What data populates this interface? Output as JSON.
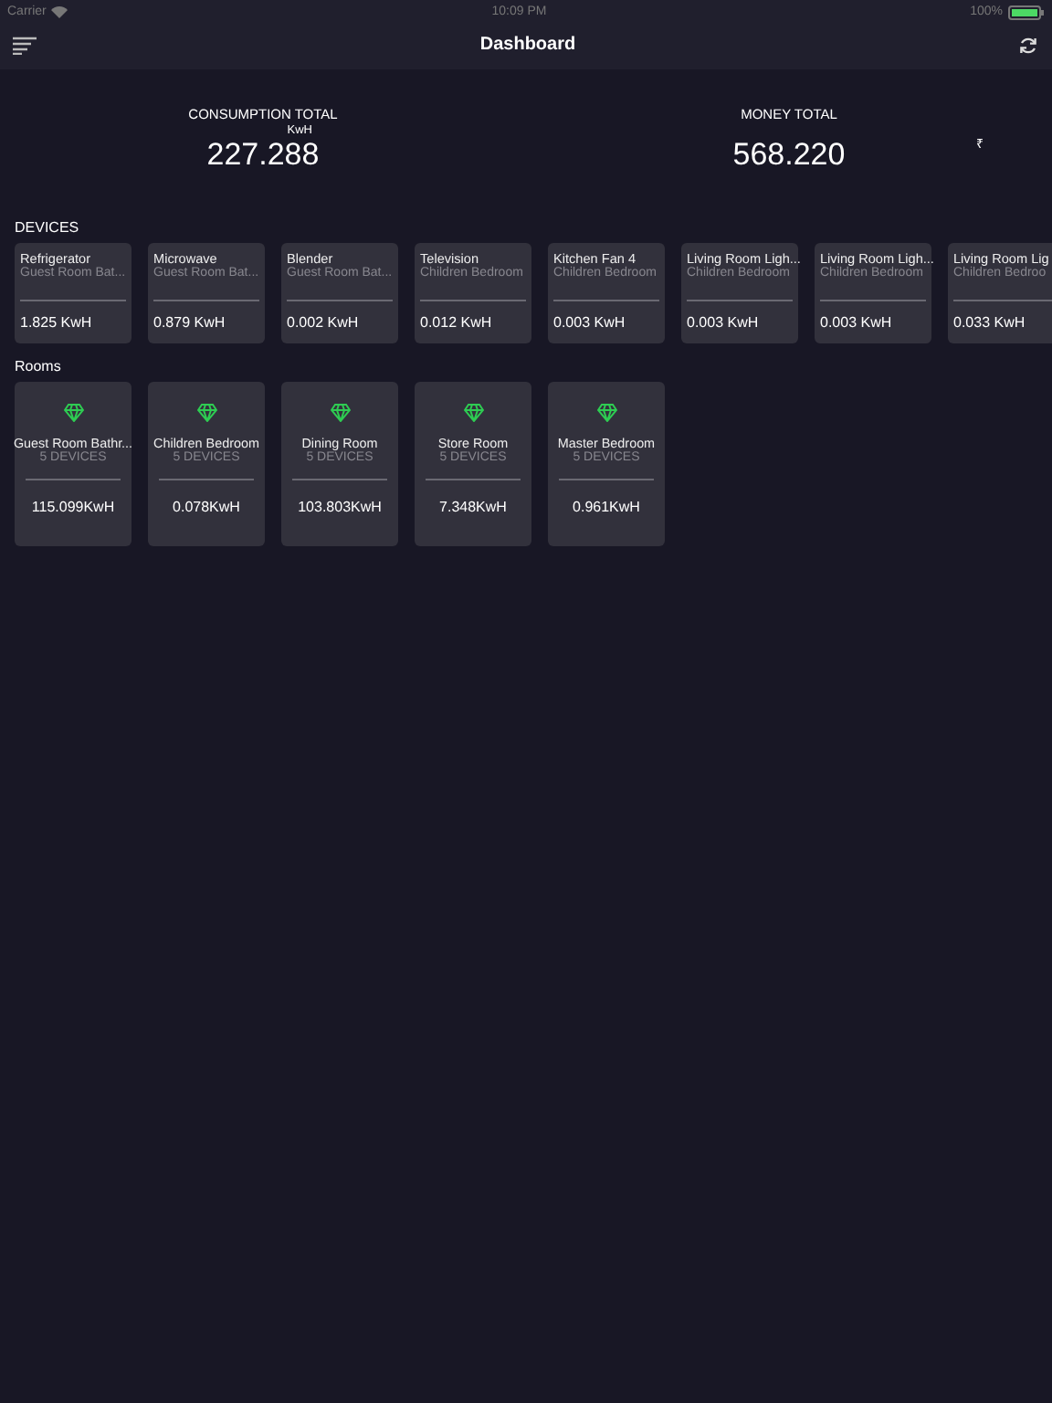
{
  "status_bar": {
    "carrier": "Carrier",
    "time": "10:09 PM",
    "battery": "100%"
  },
  "nav": {
    "title": "Dashboard"
  },
  "totals": [
    {
      "label": "CONSUMPTION TOTAL",
      "unit": "KwH",
      "value": "227.288"
    },
    {
      "label": "MONEY TOTAL",
      "unit": "₹",
      "value": "568.220"
    }
  ],
  "devices": {
    "heading": "DEVICES",
    "items": [
      {
        "name": "Refrigerator",
        "room": "Guest Room Bat...",
        "usage": "1.825 KwH"
      },
      {
        "name": "Microwave",
        "room": "Guest Room Bat...",
        "usage": "0.879 KwH"
      },
      {
        "name": "Blender",
        "room": "Guest Room Bat...",
        "usage": "0.002 KwH"
      },
      {
        "name": "Television",
        "room": "Children Bedroom",
        "usage": "0.012 KwH"
      },
      {
        "name": "Kitchen Fan 4",
        "room": "Children Bedroom",
        "usage": "0.003 KwH"
      },
      {
        "name": "Living Room Ligh...",
        "room": "Children Bedroom",
        "usage": "0.003 KwH"
      },
      {
        "name": "Living Room Ligh...",
        "room": "Children Bedroom",
        "usage": "0.003 KwH"
      },
      {
        "name": "Living Room Lig",
        "room": "Children Bedroo",
        "usage": "0.033 KwH"
      }
    ]
  },
  "rooms": {
    "heading": "Rooms",
    "items": [
      {
        "name": "Guest Room Bathr...",
        "devices": "5 DEVICES",
        "usage": "115.099KwH"
      },
      {
        "name": "Children Bedroom",
        "devices": "5 DEVICES",
        "usage": "0.078KwH"
      },
      {
        "name": "Dining Room",
        "devices": "5 DEVICES",
        "usage": "103.803KwH"
      },
      {
        "name": "Store Room",
        "devices": "5 DEVICES",
        "usage": "7.348KwH"
      },
      {
        "name": "Master Bedroom",
        "devices": "5 DEVICES",
        "usage": "0.961KwH"
      }
    ]
  }
}
